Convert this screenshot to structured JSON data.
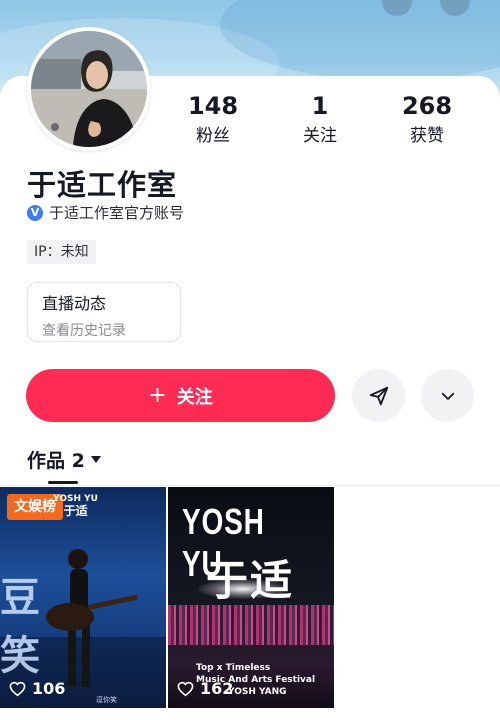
{
  "profile": {
    "name": "于适工作室",
    "verified_text": "于适工作室官方账号",
    "ip_label": "IP：未知",
    "avatar_desc": "avatar"
  },
  "stats": [
    {
      "value": "148",
      "label": "粉丝"
    },
    {
      "value": "1",
      "label": "关注"
    },
    {
      "value": "268",
      "label": "获赞"
    }
  ],
  "live_card": {
    "title": "直播动态",
    "subtitle": "查看历史记录"
  },
  "actions": {
    "follow_plus": "+",
    "follow_label": "关注",
    "share_icon": "send-icon",
    "more_icon": "chevron-down-icon"
  },
  "tabs": {
    "works_label": "作品 2"
  },
  "videos": [
    {
      "badge": "文娱榜",
      "brand_en": "YOSH YU",
      "brand_cn": "于适",
      "big_text": "豆 笑",
      "bottom_text": "逗你笑",
      "likes": "106"
    },
    {
      "brand_en": "YOSH YU",
      "brand_cn": "于适",
      "line1": "Top x Timeless",
      "line2": "Music And Arts Festival",
      "line3": "YOSH YANG",
      "likes": "162"
    }
  ],
  "colors": {
    "accent": "#fe2c55",
    "verify": "#3c7cf5",
    "badge": "#f36a1f"
  }
}
